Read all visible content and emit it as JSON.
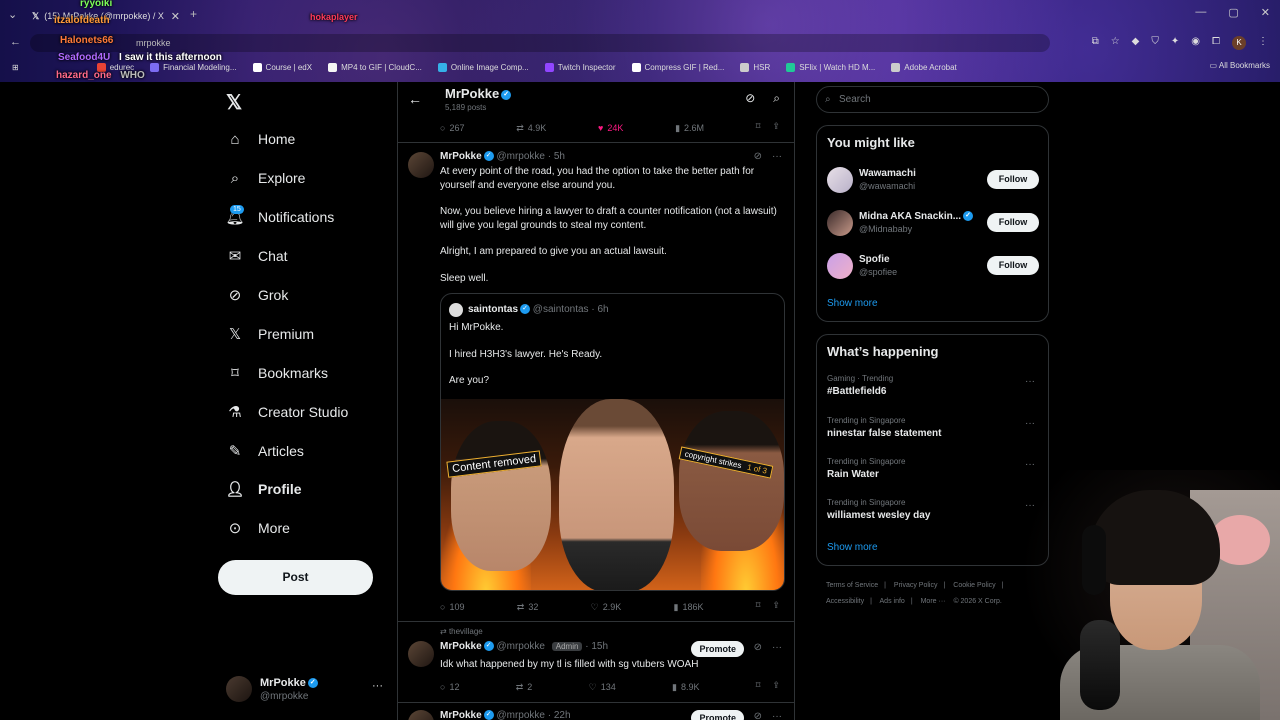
{
  "browser": {
    "tab_title": "(15) MrPokke (@mrpokke) / X",
    "url_fragment": "mrpokke",
    "bookmarks": [
      {
        "label": "edurec",
        "color": "#e94335"
      },
      {
        "label": "Financial Modeling...",
        "color": "#7c6cf2"
      },
      {
        "label": "Course | edX",
        "color": "#ffffff"
      },
      {
        "label": "MP4 to GIF | CloudC...",
        "color": "#f5f5f5"
      },
      {
        "label": "Online Image Comp...",
        "color": "#35b1e8"
      },
      {
        "label": "Twitch Inspector",
        "color": "#9146ff"
      },
      {
        "label": "Compress GIF | Red...",
        "color": "#ffffff"
      },
      {
        "label": "HSR",
        "color": "#cccccc"
      },
      {
        "label": "SFlix | Watch HD M...",
        "color": "#20c997"
      },
      {
        "label": "Adobe Acrobat",
        "color": "#cccccc"
      }
    ],
    "all_bookmarks": "All Bookmarks",
    "profile_initial": "K"
  },
  "chat": [
    {
      "user": "ryyoiki",
      "text": "",
      "color": "#7dff5a"
    },
    {
      "user": "itzalofdeath",
      "text": "",
      "color": "#ff9a3a"
    },
    {
      "user": "hokaplayer",
      "text": "",
      "color": "#ff3a5a"
    },
    {
      "user": "Halonets66",
      "text": "",
      "color": "#ff7a3a"
    },
    {
      "user": "Seafood4U",
      "text": "I saw it this afternoon",
      "color": "#b06aff"
    },
    {
      "user": "hazard_one",
      "text": "WHO",
      "color": "#ff6a8a"
    }
  ],
  "nav": {
    "items": [
      {
        "label": "Home",
        "icon": "home-icon"
      },
      {
        "label": "Explore",
        "icon": "search-icon"
      },
      {
        "label": "Notifications",
        "icon": "bell-icon"
      },
      {
        "label": "Chat",
        "icon": "mail-icon"
      },
      {
        "label": "Grok",
        "icon": "grok-icon"
      },
      {
        "label": "Premium",
        "icon": "x-icon"
      },
      {
        "label": "Bookmarks",
        "icon": "bookmark-icon"
      },
      {
        "label": "Creator Studio",
        "icon": "flask-icon"
      },
      {
        "label": "Articles",
        "icon": "article-icon"
      },
      {
        "label": "Profile",
        "icon": "person-icon"
      },
      {
        "label": "More",
        "icon": "more-icon"
      }
    ],
    "notif_count": "15",
    "post_label": "Post",
    "me_name": "MrPokke",
    "me_handle": "@mrpokke"
  },
  "header": {
    "title": "MrPokke",
    "post_count": "5,189 posts"
  },
  "prev_tweet_actions": {
    "replies": "267",
    "reposts": "4.9K",
    "likes": "24K",
    "views": "2.6M"
  },
  "tweet1": {
    "name": "MrPokke",
    "handle": "@mrpokke",
    "time": "5h",
    "p1": "At every point of the road, you had the option to take the better path for yourself and everyone else around you.",
    "p2": "Now, you believe hiring a lawyer to draft a counter notification (not a lawsuit) will give you legal grounds to steal my content.",
    "p3": "Alright, I am prepared to give you an actual lawsuit.",
    "p4": "Sleep well.",
    "quote": {
      "name": "saintontas",
      "handle": "@saintontas",
      "time": "6h",
      "l1": "Hi MrPokke.",
      "l2": "I hired H3H3's lawyer. He's Ready.",
      "l3": "Are you?",
      "banner_left": "Content removed",
      "banner_right": "copyright strikes",
      "banner_right_sub": "1 of 3"
    },
    "actions": {
      "replies": "109",
      "reposts": "32",
      "likes": "2.9K",
      "views": "186K"
    }
  },
  "tweet2": {
    "repost_by": "thevillage",
    "name": "MrPokke",
    "handle": "@mrpokke",
    "badge": "Admin",
    "time": "15h",
    "promote": "Promote",
    "text": "Idk what happened by my tl is filled with sg vtubers WOAH",
    "actions": {
      "replies": "12",
      "reposts": "2",
      "likes": "134",
      "views": "8.9K"
    }
  },
  "tweet3": {
    "name": "MrPokke",
    "handle": "@mrpokke",
    "time": "22h",
    "promote": "Promote"
  },
  "right": {
    "search_placeholder": "Search",
    "might_like_title": "You might like",
    "suggestions": [
      {
        "name": "Wawamachi",
        "handle": "@wawamachi",
        "follow": "Follow",
        "verified": false
      },
      {
        "name": "Midna AKA Snackin...",
        "handle": "@Midnababy",
        "follow": "Follow",
        "verified": true
      },
      {
        "name": "Spofie",
        "handle": "@spofiee",
        "follow": "Follow",
        "verified": false
      }
    ],
    "show_more": "Show more",
    "happening_title": "What’s happening",
    "trends": [
      {
        "context": "Gaming · Trending",
        "topic": "#Battlefield6"
      },
      {
        "context": "Trending in Singapore",
        "topic": "ninestar false statement"
      },
      {
        "context": "Trending in Singapore",
        "topic": "Rain Water"
      },
      {
        "context": "Trending in Singapore",
        "topic": "williamest wesley day"
      }
    ],
    "show_more2": "Show more",
    "footer": [
      "Terms of Service",
      "|",
      "Privacy Policy",
      "|",
      "Cookie Policy",
      "|",
      "Accessibility",
      "|",
      "Ads info",
      "|",
      "More ···",
      "© 2026 X Corp."
    ]
  },
  "colors": {
    "accent": "#1d9bf0",
    "like": "#f91880",
    "bg": "#000000",
    "border": "#2f3336"
  }
}
